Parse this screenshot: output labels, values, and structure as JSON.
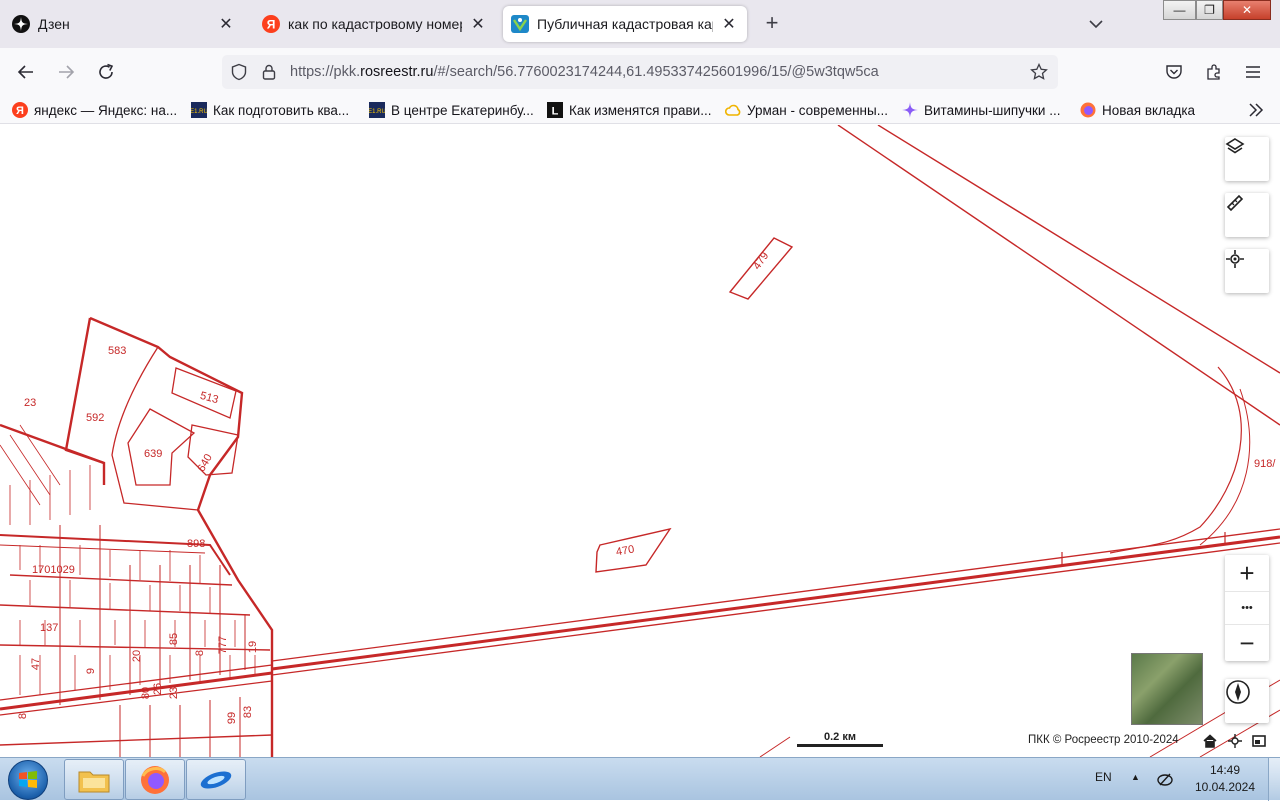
{
  "browser": {
    "tabs": [
      {
        "title": "Дзен",
        "icon": "dzen-icon",
        "active": false
      },
      {
        "title": "как по кадастровому номеру",
        "icon": "yandex-icon",
        "active": false
      },
      {
        "title": "Публичная кадастровая карта",
        "icon": "rosreestr-icon",
        "active": true
      }
    ],
    "new_tab_label": "+",
    "url_prefix": "https://pkk.",
    "url_domain": "rosreestr.ru",
    "url_path": "/#/search/56.7760023174244,61.495337425601996/15/@5w3tqw5ca",
    "bookmarks": [
      {
        "label": "яндекс — Яндекс: на...",
        "icon": "yandex-icon"
      },
      {
        "label": "Как подготовить ква...",
        "icon": "e1-icon"
      },
      {
        "label": "В центре Екатеринбу...",
        "icon": "e1-icon"
      },
      {
        "label": "Как изменятся прави...",
        "icon": "l-icon"
      },
      {
        "label": "Урман - современны...",
        "icon": "cloud-icon"
      },
      {
        "label": "Витамины-шипучки ...",
        "icon": "sparkle-icon"
      },
      {
        "label": "Новая вкладка",
        "icon": "firefox-icon"
      }
    ]
  },
  "map": {
    "parcels": [
      "479",
      "583",
      "23",
      "592",
      "513",
      "639",
      "640",
      "918/",
      "898",
      "1701029",
      "470",
      "137",
      "85",
      "47",
      "9",
      "20",
      "8",
      "777",
      "19",
      "80",
      "26",
      "23",
      "99",
      "83",
      "8"
    ],
    "scale_label": "0.2 км",
    "copyright": "ПКК © Росреестр 2010-2024",
    "zoom_in": "+",
    "zoom_more": "•••",
    "zoom_out": "−"
  },
  "taskbar": {
    "lang": "EN",
    "time": "14:49",
    "date": "10.04.2024"
  },
  "colors": {
    "parcel_line": "#c62828",
    "tabstrip_bg": "#e9e7ee",
    "toolbar_bg": "#f9f9fb"
  }
}
